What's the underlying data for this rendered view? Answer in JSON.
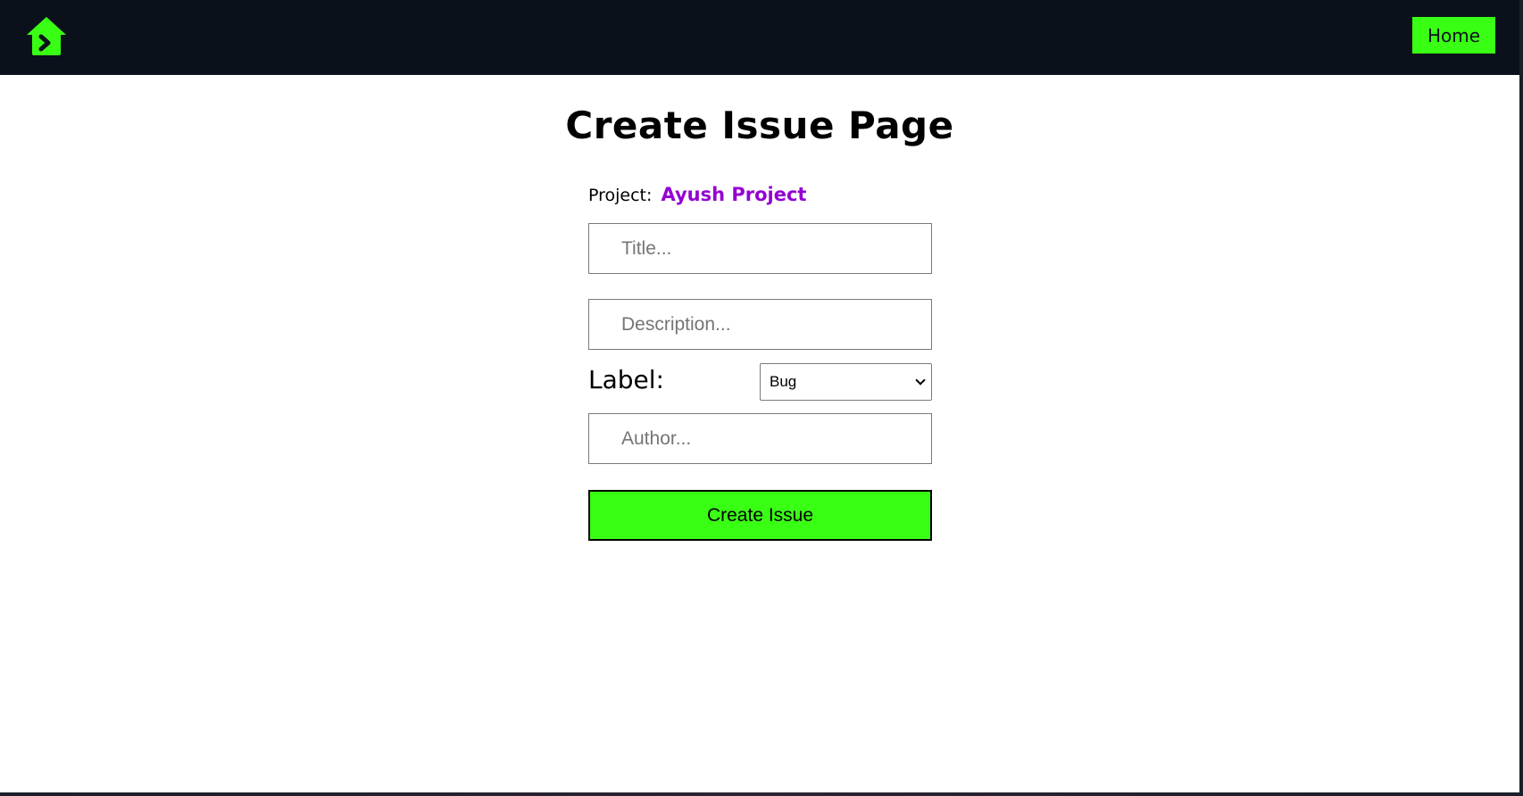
{
  "navbar": {
    "logo_icon": "home-icon",
    "home_label": "Home"
  },
  "main": {
    "title": "Create Issue Page",
    "project_prefix": "Project:",
    "project_name": "Ayush Project"
  },
  "form": {
    "title_placeholder": "Title...",
    "description_placeholder": "Description...",
    "label_text": "Label:",
    "label_selected": "Bug",
    "author_placeholder": "Author...",
    "submit_label": "Create Issue"
  },
  "colors": {
    "navbar_bg": "#0b111b",
    "accent_green": "#39ff14",
    "project_purple": "#9400d3"
  }
}
